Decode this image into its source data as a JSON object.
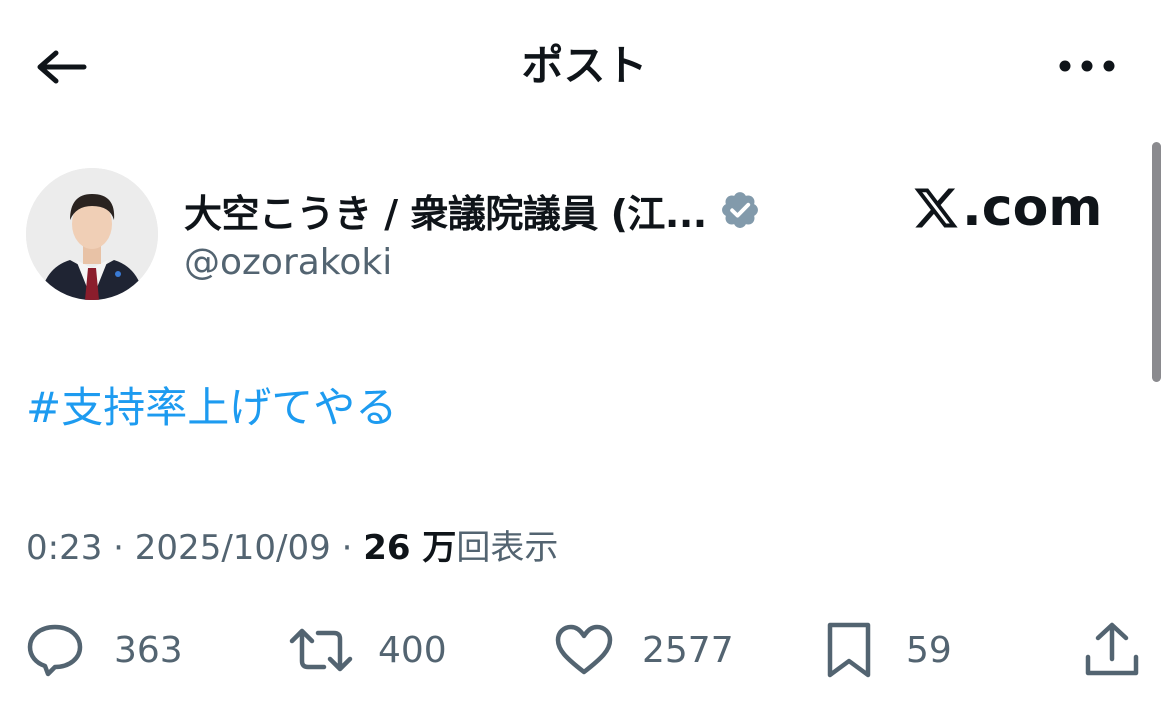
{
  "header": {
    "title": "ポスト"
  },
  "author": {
    "display_name": "大空こうき / 衆議院議員 (江...",
    "handle": "@ozorakoki",
    "verified": true,
    "verified_color": "#829aab"
  },
  "watermark": {
    "text": ".com",
    "logo_letter": "X"
  },
  "post": {
    "text": "#支持率上げてやる",
    "link_color": "#1d9bf0"
  },
  "meta": {
    "time": "0:23",
    "separator": " · ",
    "date": "2025/10/09",
    "views_count": "26 万",
    "views_label": "回表示"
  },
  "actions": {
    "replies": "363",
    "reposts": "400",
    "likes": "2577",
    "bookmarks": "59"
  },
  "icons": {
    "back": "arrow-left-icon",
    "more": "more-horizontal-icon",
    "reply": "comment-icon",
    "repost": "repost-icon",
    "like": "heart-icon",
    "bookmark": "bookmark-icon",
    "share": "share-icon"
  },
  "colors": {
    "text_primary": "#0f1419",
    "text_secondary": "#536471",
    "accent": "#1d9bf0"
  }
}
